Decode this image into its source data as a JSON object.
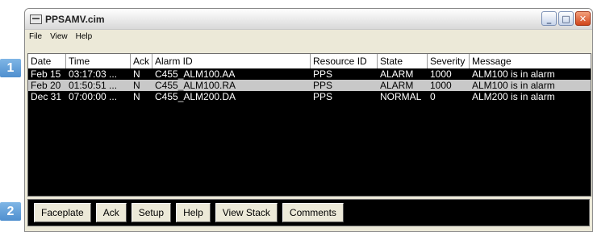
{
  "window": {
    "title": "PPSAMV.cim"
  },
  "menu": [
    "File",
    "View",
    "Help"
  ],
  "callouts": {
    "list": "1",
    "buttons": "2"
  },
  "columns": {
    "date": "Date",
    "time": "Time",
    "ack": "Ack",
    "alarm_id": "Alarm ID",
    "resource_id": "Resource ID",
    "state": "State",
    "severity": "Severity",
    "message": "Message"
  },
  "rows": [
    {
      "date": "Feb 15",
      "time": "03:17:03 ...",
      "ack": "N",
      "alarm_id": "C455_ALM100.AA",
      "resource_id": "PPS",
      "state": "ALARM",
      "severity": "1000",
      "message": "ALM100 is in alarm",
      "selected": false
    },
    {
      "date": "Feb 20",
      "time": "01:50:51 ...",
      "ack": "N",
      "alarm_id": "C455_ALM100.RA",
      "resource_id": "PPS",
      "state": "ALARM",
      "severity": "1000",
      "message": "ALM100 is in alarm",
      "selected": true
    },
    {
      "date": "Dec 31",
      "time": "07:00:00 ...",
      "ack": "N",
      "alarm_id": "C455_ALM200.DA",
      "resource_id": "PPS",
      "state": "NORMAL",
      "severity": "0",
      "message": "ALM200 is in alarm",
      "selected": false
    }
  ],
  "buttons": [
    "Faceplate",
    "Ack",
    "Setup",
    "Help",
    "View Stack",
    "Comments"
  ],
  "colors": {
    "list_bg": "#000000",
    "selected_row": "#c8c8c8",
    "callout": "#5b9bd5"
  }
}
